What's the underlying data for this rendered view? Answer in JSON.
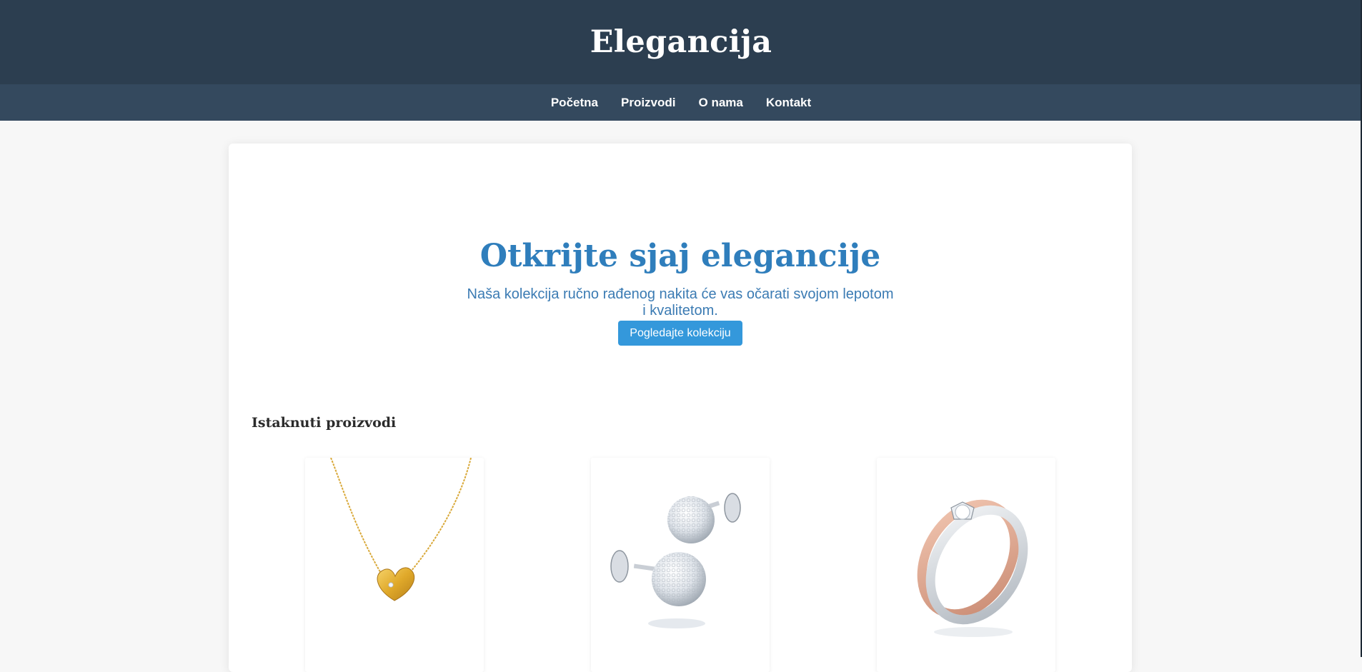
{
  "header": {
    "site_title": "Elegancija"
  },
  "nav": {
    "items": [
      {
        "label": "Početna"
      },
      {
        "label": "Proizvodi"
      },
      {
        "label": "O nama"
      },
      {
        "label": "Kontakt"
      }
    ]
  },
  "hero": {
    "title": "Otkrijte sjaj elegancije",
    "subtitle": "Naša kolekcija ručno rađenog nakita će vas očarati svojom lepotom i kvalitetom.",
    "button_label": "Pogledajte kolekciju"
  },
  "featured": {
    "title": "Istaknuti proizvodi",
    "products": [
      {
        "image": "gold-heart-necklace"
      },
      {
        "image": "crystal-ball-stud-earrings"
      },
      {
        "image": "rose-gold-silver-diamond-ring"
      }
    ]
  },
  "colors": {
    "header_bg": "#2c3e50",
    "nav_bg": "#34495e",
    "accent": "#3498db",
    "hero_title": "#2f7ebc"
  }
}
